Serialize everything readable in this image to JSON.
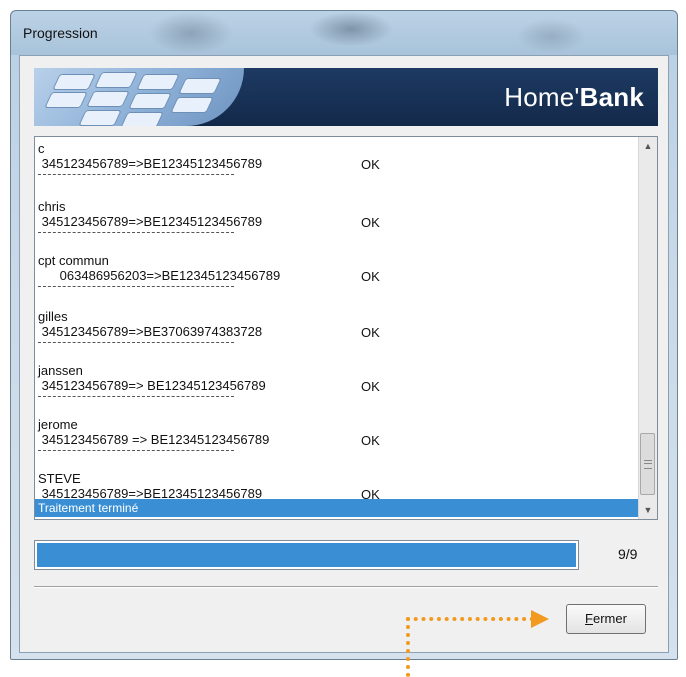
{
  "window": {
    "title": "Progression"
  },
  "banner": {
    "brand_prefix": "Home'",
    "brand_bold": "Bank"
  },
  "log": {
    "entries": [
      {
        "name": "c",
        "line": " 345123456789=>BE12345123456789",
        "status": "OK"
      },
      {
        "name": "chris",
        "line": " 345123456789=>BE12345123456789",
        "status": "OK"
      },
      {
        "name": "cpt commun",
        "line": "      063486956203=>BE12345123456789",
        "status": "OK"
      },
      {
        "name": "gilles",
        "line": " 345123456789=>BE37063974383728",
        "status": "OK"
      },
      {
        "name": "janssen",
        "line": " 345123456789=> BE12345123456789",
        "status": "OK"
      },
      {
        "name": "jerome",
        "line": " 345123456789 => BE12345123456789",
        "status": "OK"
      },
      {
        "name": "STEVE",
        "line": " 345123456789=>BE12345123456789",
        "status": "OK"
      }
    ],
    "final_message": "Traitement terminé"
  },
  "progress": {
    "fraction": 1.0,
    "count_text": "9/9"
  },
  "buttons": {
    "close_first": "F",
    "close_rest": "ermer"
  },
  "colors": {
    "accent": "#3a8fd4",
    "banner": "#13294a",
    "annotation": "#f29a1f"
  }
}
